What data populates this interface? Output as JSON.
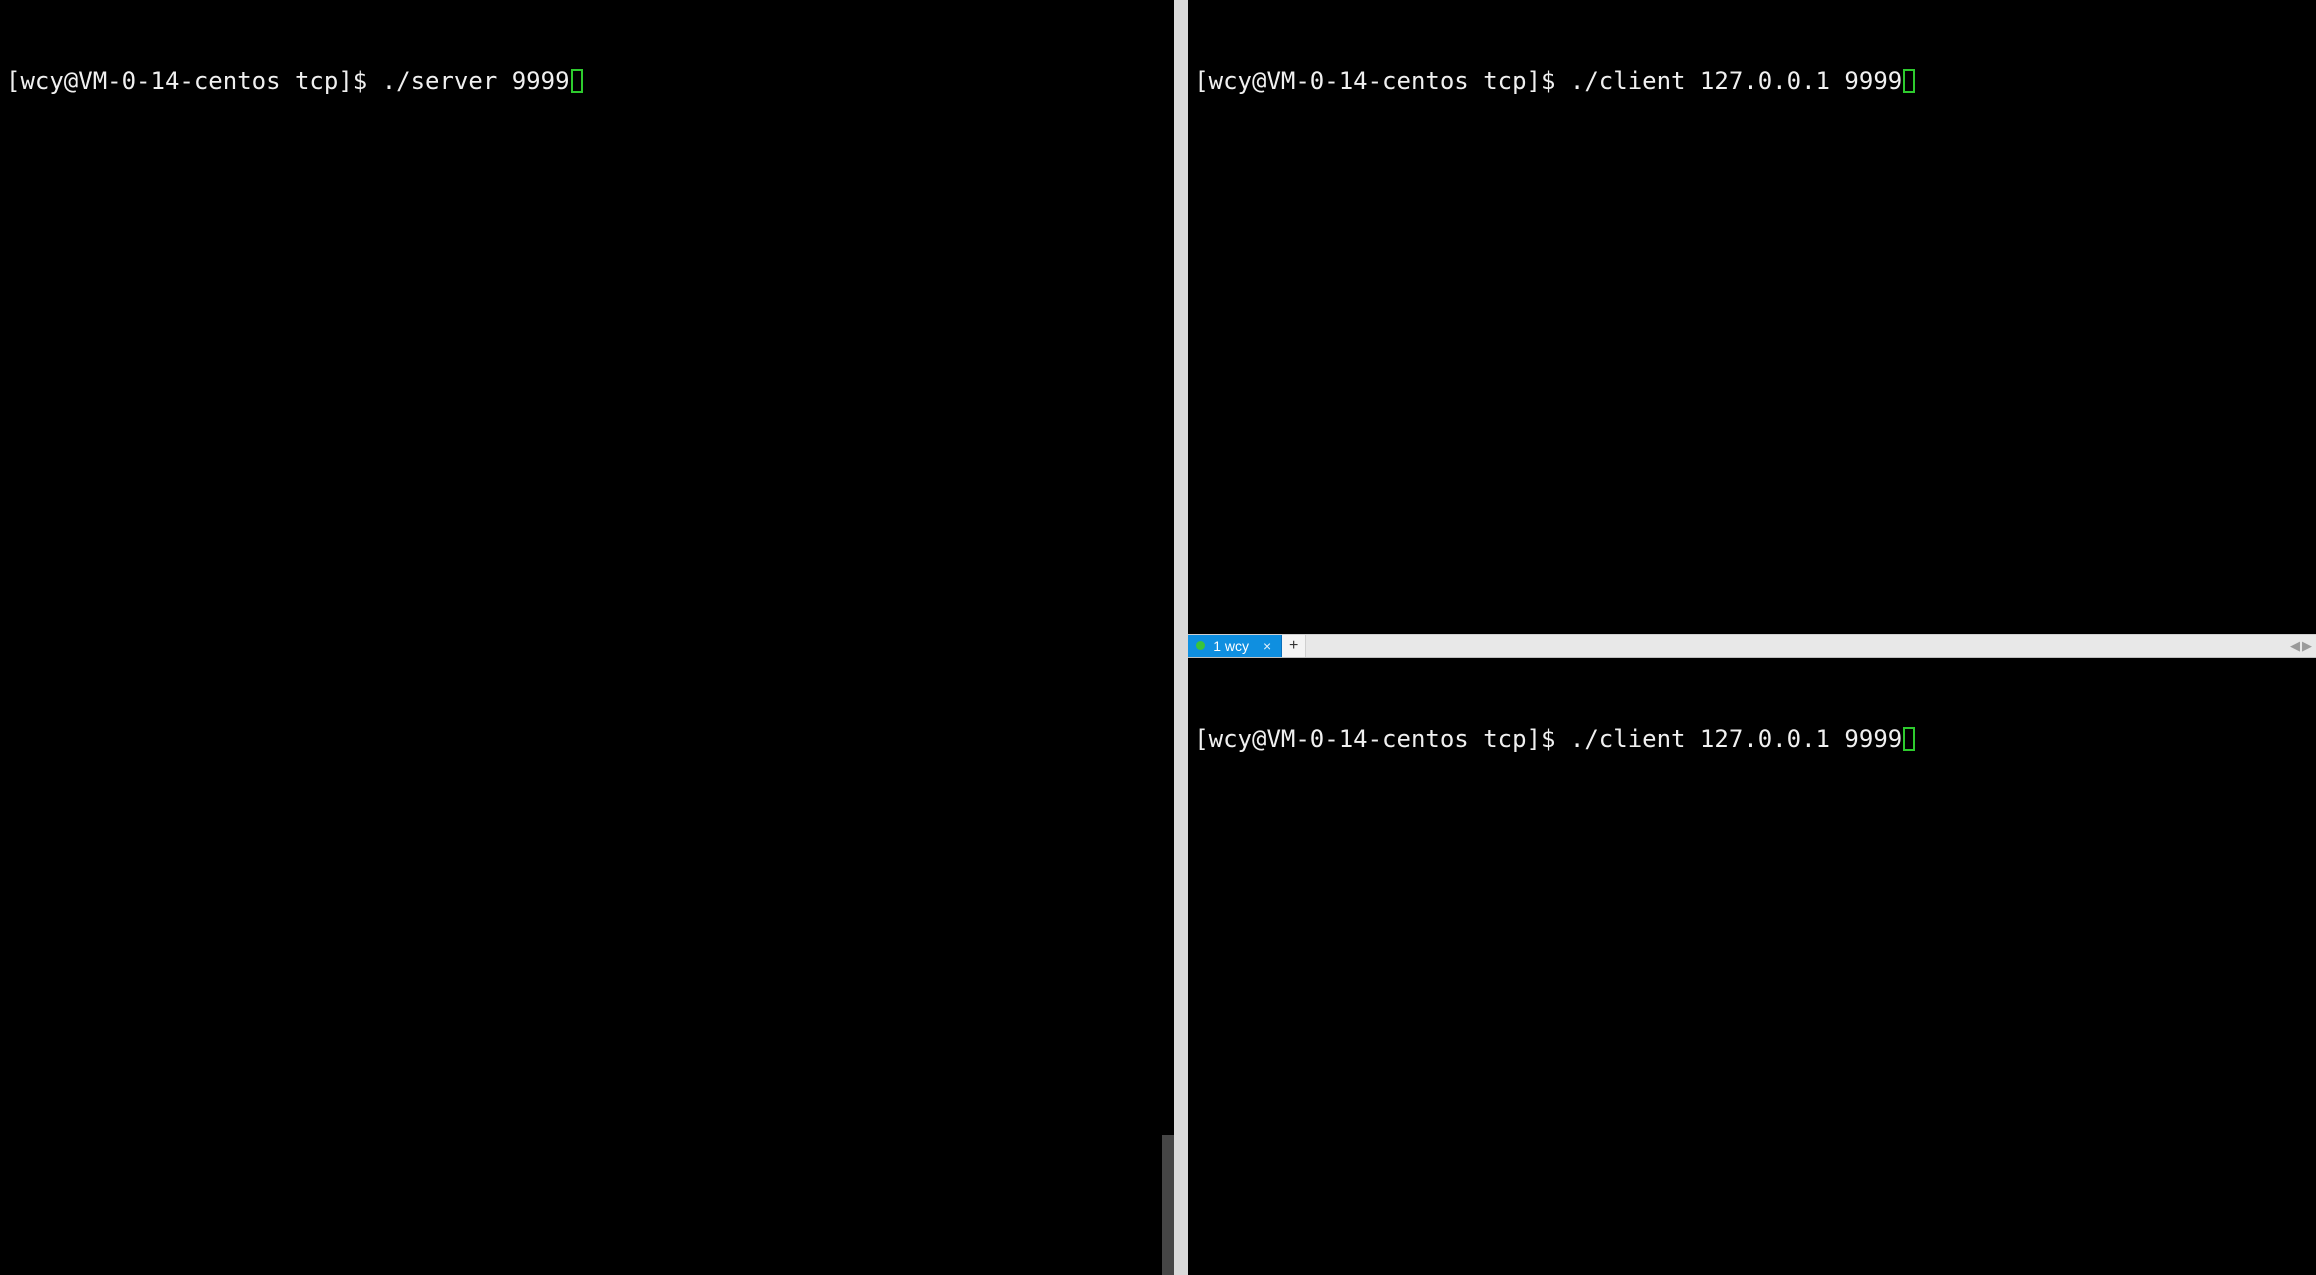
{
  "left_pane": {
    "prompt": "[wcy@VM-0-14-centos tcp]$ ",
    "command": "./server 9999"
  },
  "right_top_pane": {
    "prompt": "[wcy@VM-0-14-centos tcp]$ ",
    "command": "./client 127.0.0.1 9999"
  },
  "right_bottom_pane": {
    "prompt": "[wcy@VM-0-14-centos tcp]$ ",
    "command": "./client 127.0.0.1 9999"
  },
  "tabs": {
    "active": {
      "index_label": "1",
      "title": "wcy"
    },
    "new_tab_glyph": "+",
    "scroll_left_glyph": "◀",
    "scroll_right_glyph": "▶"
  },
  "colors": {
    "cursor_border": "#2ecb2e",
    "tab_active_bg": "#0f8fe0",
    "status_dot": "#3ac43a",
    "terminal_bg": "#000000",
    "terminal_fg": "#f0f0f0"
  }
}
